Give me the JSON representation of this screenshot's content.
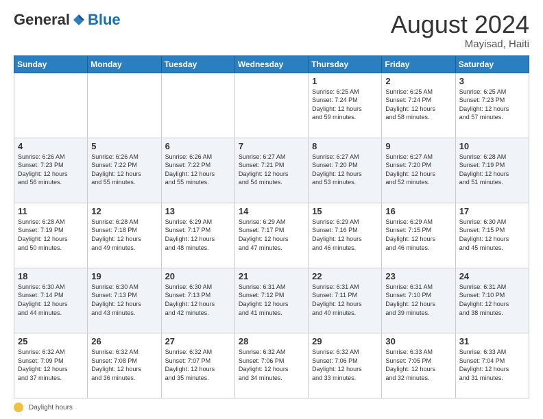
{
  "header": {
    "logo_general": "General",
    "logo_blue": "Blue",
    "month_title": "August 2024",
    "location": "Mayisad, Haiti"
  },
  "footer": {
    "daylight_label": "Daylight hours"
  },
  "days_of_week": [
    "Sunday",
    "Monday",
    "Tuesday",
    "Wednesday",
    "Thursday",
    "Friday",
    "Saturday"
  ],
  "weeks": [
    [
      {
        "day": "",
        "info": ""
      },
      {
        "day": "",
        "info": ""
      },
      {
        "day": "",
        "info": ""
      },
      {
        "day": "",
        "info": ""
      },
      {
        "day": "1",
        "info": "Sunrise: 6:25 AM\nSunset: 7:24 PM\nDaylight: 12 hours\nand 59 minutes."
      },
      {
        "day": "2",
        "info": "Sunrise: 6:25 AM\nSunset: 7:24 PM\nDaylight: 12 hours\nand 58 minutes."
      },
      {
        "day": "3",
        "info": "Sunrise: 6:25 AM\nSunset: 7:23 PM\nDaylight: 12 hours\nand 57 minutes."
      }
    ],
    [
      {
        "day": "4",
        "info": "Sunrise: 6:26 AM\nSunset: 7:23 PM\nDaylight: 12 hours\nand 56 minutes."
      },
      {
        "day": "5",
        "info": "Sunrise: 6:26 AM\nSunset: 7:22 PM\nDaylight: 12 hours\nand 55 minutes."
      },
      {
        "day": "6",
        "info": "Sunrise: 6:26 AM\nSunset: 7:22 PM\nDaylight: 12 hours\nand 55 minutes."
      },
      {
        "day": "7",
        "info": "Sunrise: 6:27 AM\nSunset: 7:21 PM\nDaylight: 12 hours\nand 54 minutes."
      },
      {
        "day": "8",
        "info": "Sunrise: 6:27 AM\nSunset: 7:20 PM\nDaylight: 12 hours\nand 53 minutes."
      },
      {
        "day": "9",
        "info": "Sunrise: 6:27 AM\nSunset: 7:20 PM\nDaylight: 12 hours\nand 52 minutes."
      },
      {
        "day": "10",
        "info": "Sunrise: 6:28 AM\nSunset: 7:19 PM\nDaylight: 12 hours\nand 51 minutes."
      }
    ],
    [
      {
        "day": "11",
        "info": "Sunrise: 6:28 AM\nSunset: 7:19 PM\nDaylight: 12 hours\nand 50 minutes."
      },
      {
        "day": "12",
        "info": "Sunrise: 6:28 AM\nSunset: 7:18 PM\nDaylight: 12 hours\nand 49 minutes."
      },
      {
        "day": "13",
        "info": "Sunrise: 6:29 AM\nSunset: 7:17 PM\nDaylight: 12 hours\nand 48 minutes."
      },
      {
        "day": "14",
        "info": "Sunrise: 6:29 AM\nSunset: 7:17 PM\nDaylight: 12 hours\nand 47 minutes."
      },
      {
        "day": "15",
        "info": "Sunrise: 6:29 AM\nSunset: 7:16 PM\nDaylight: 12 hours\nand 46 minutes."
      },
      {
        "day": "16",
        "info": "Sunrise: 6:29 AM\nSunset: 7:15 PM\nDaylight: 12 hours\nand 46 minutes."
      },
      {
        "day": "17",
        "info": "Sunrise: 6:30 AM\nSunset: 7:15 PM\nDaylight: 12 hours\nand 45 minutes."
      }
    ],
    [
      {
        "day": "18",
        "info": "Sunrise: 6:30 AM\nSunset: 7:14 PM\nDaylight: 12 hours\nand 44 minutes."
      },
      {
        "day": "19",
        "info": "Sunrise: 6:30 AM\nSunset: 7:13 PM\nDaylight: 12 hours\nand 43 minutes."
      },
      {
        "day": "20",
        "info": "Sunrise: 6:30 AM\nSunset: 7:13 PM\nDaylight: 12 hours\nand 42 minutes."
      },
      {
        "day": "21",
        "info": "Sunrise: 6:31 AM\nSunset: 7:12 PM\nDaylight: 12 hours\nand 41 minutes."
      },
      {
        "day": "22",
        "info": "Sunrise: 6:31 AM\nSunset: 7:11 PM\nDaylight: 12 hours\nand 40 minutes."
      },
      {
        "day": "23",
        "info": "Sunrise: 6:31 AM\nSunset: 7:10 PM\nDaylight: 12 hours\nand 39 minutes."
      },
      {
        "day": "24",
        "info": "Sunrise: 6:31 AM\nSunset: 7:10 PM\nDaylight: 12 hours\nand 38 minutes."
      }
    ],
    [
      {
        "day": "25",
        "info": "Sunrise: 6:32 AM\nSunset: 7:09 PM\nDaylight: 12 hours\nand 37 minutes."
      },
      {
        "day": "26",
        "info": "Sunrise: 6:32 AM\nSunset: 7:08 PM\nDaylight: 12 hours\nand 36 minutes."
      },
      {
        "day": "27",
        "info": "Sunrise: 6:32 AM\nSunset: 7:07 PM\nDaylight: 12 hours\nand 35 minutes."
      },
      {
        "day": "28",
        "info": "Sunrise: 6:32 AM\nSunset: 7:06 PM\nDaylight: 12 hours\nand 34 minutes."
      },
      {
        "day": "29",
        "info": "Sunrise: 6:32 AM\nSunset: 7:06 PM\nDaylight: 12 hours\nand 33 minutes."
      },
      {
        "day": "30",
        "info": "Sunrise: 6:33 AM\nSunset: 7:05 PM\nDaylight: 12 hours\nand 32 minutes."
      },
      {
        "day": "31",
        "info": "Sunrise: 6:33 AM\nSunset: 7:04 PM\nDaylight: 12 hours\nand 31 minutes."
      }
    ]
  ]
}
